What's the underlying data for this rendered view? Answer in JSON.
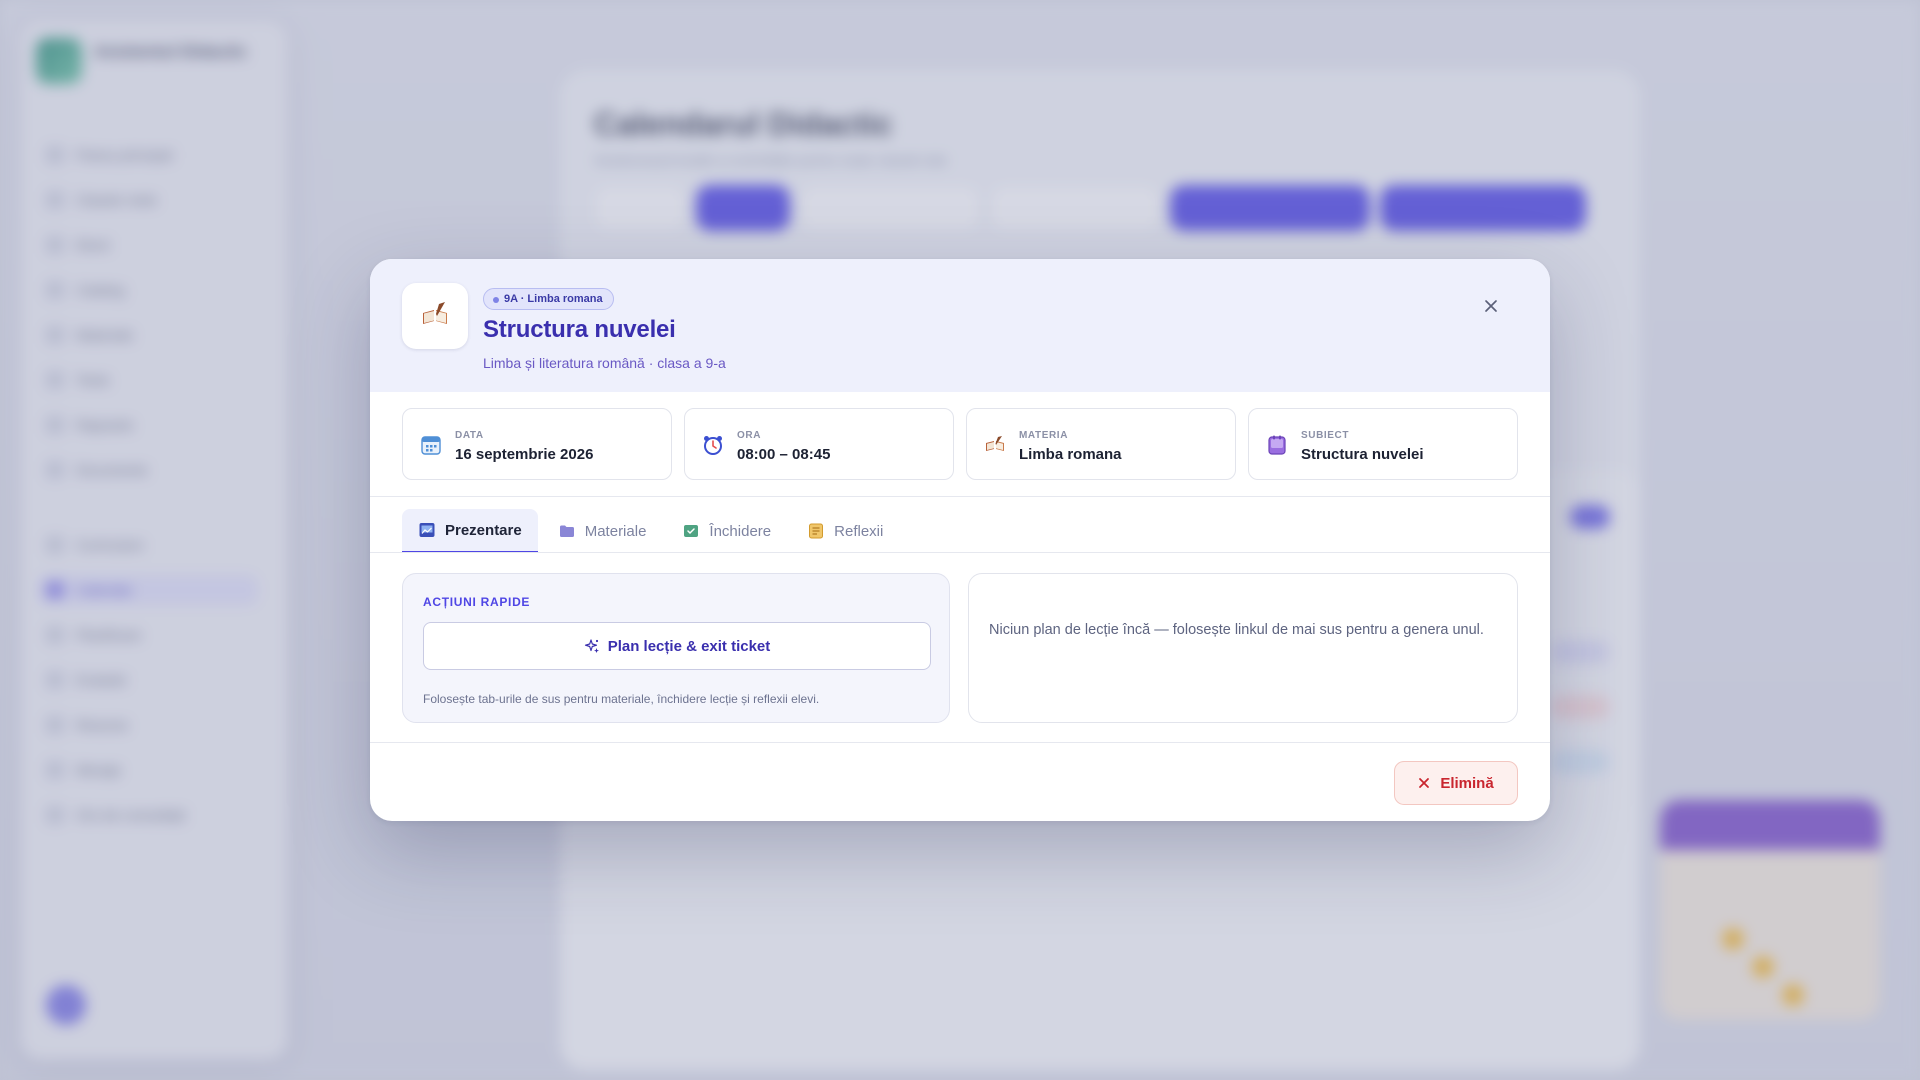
{
  "background": {
    "brand_name": "Asistentul Didactic",
    "page_title": "Calendarul Didactic",
    "page_subtitle": "Gestionează lecțiile și activitățile pentru toate clasele tale",
    "nav_items": [
      "Panou principal",
      "Clasele mele",
      "Elevii",
      "Catalog",
      "Materiale",
      "Teste",
      "Rapoarte",
      "Documente",
      "Curriculum",
      "Calendar",
      "Planificare",
      "Evaluări",
      "Resurse",
      "Mesaje",
      "Ore de consultații"
    ]
  },
  "modal": {
    "badge": "9A · Limba romana",
    "title": "Structura nuvelei",
    "subtitle": "Limba și literatura română · clasa a 9-a",
    "header_icon": "book-quill-icon",
    "info_cards": [
      {
        "label": "DATA",
        "value": "16 septembrie 2026",
        "icon": "calendar-icon"
      },
      {
        "label": "ORA",
        "value": "08:00 – 08:45",
        "icon": "alarm-clock-icon"
      },
      {
        "label": "MATERIA",
        "value": "Limba romana",
        "icon": "book-quill-icon"
      },
      {
        "label": "SUBIECT",
        "value": "Structura nuvelei",
        "icon": "notebook-icon"
      }
    ],
    "tabs": [
      {
        "label": "Prezentare",
        "icon": "presentation-icon",
        "active": true
      },
      {
        "label": "Materiale",
        "icon": "folder-icon",
        "active": false
      },
      {
        "label": "Închidere",
        "icon": "exit-ticket-icon",
        "active": false
      },
      {
        "label": "Reflexii",
        "icon": "reflection-note-icon",
        "active": false
      }
    ],
    "quick_actions": {
      "title": "ACȚIUNI RAPIDE",
      "plan_button": "Plan lecție & exit ticket",
      "hint": "Folosește tab-urile de sus pentru materiale, închidere lecție și reflexii elevi."
    },
    "plan_empty": "Niciun plan de lecție încă — folosește linkul de mai sus pentru a genera unul.",
    "delete_button": "Elimină",
    "colors": {
      "accent": "#4f46e5",
      "title": "#3a2fae",
      "header_bg": "#eef0fc",
      "danger": "#c9262f"
    }
  }
}
